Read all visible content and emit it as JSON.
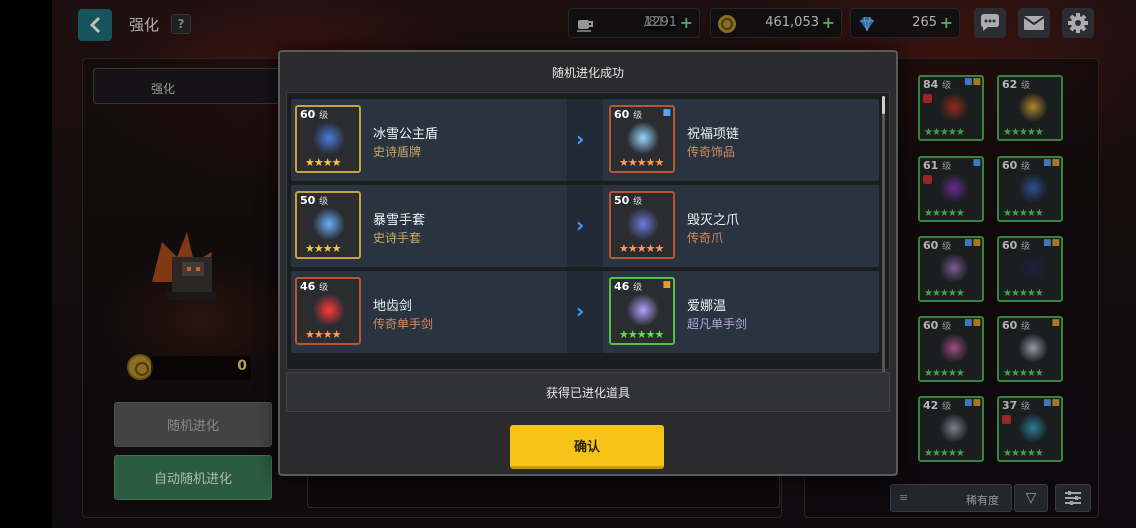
{
  "header": {
    "title": "强化",
    "help_label": "?",
    "stamina": {
      "current": "1291",
      "max": "/81"
    },
    "gold": "461,053",
    "gems": "265",
    "plus": "+"
  },
  "left": {
    "tab_label": "强化",
    "cost": "0",
    "random_evolve_label": "随机进化",
    "auto_evolve_label": "自动随机进化"
  },
  "inventory": {
    "items": [
      {
        "level": "84",
        "unit": "级",
        "stars": "★★★★★",
        "locked": true,
        "badges": [
          "blue",
          "orange"
        ]
      },
      {
        "level": "62",
        "unit": "级",
        "stars": "★★★★★",
        "locked": false,
        "badges": []
      },
      {
        "level": "61",
        "unit": "级",
        "stars": "★★★★★",
        "locked": true,
        "badges": [
          "blue"
        ]
      },
      {
        "level": "60",
        "unit": "级",
        "stars": "★★★★★",
        "locked": false,
        "badges": [
          "blue",
          "orange"
        ]
      },
      {
        "level": "60",
        "unit": "级",
        "stars": "★★★★★",
        "locked": false,
        "badges": [
          "blue",
          "orange"
        ]
      },
      {
        "level": "60",
        "unit": "级",
        "stars": "★★★★★",
        "locked": false,
        "badges": [
          "blue",
          "orange"
        ]
      },
      {
        "level": "60",
        "unit": "级",
        "stars": "★★★★★",
        "locked": false,
        "badges": [
          "blue",
          "orange"
        ]
      },
      {
        "level": "60",
        "unit": "级",
        "stars": "★★★★★",
        "locked": false,
        "badges": [
          "orange"
        ]
      },
      {
        "level": "42",
        "unit": "级",
        "stars": "★★★★★",
        "locked": false,
        "badges": [
          "blue",
          "orange"
        ]
      },
      {
        "level": "37",
        "unit": "级",
        "stars": "★★★★★",
        "locked": true,
        "badges": [
          "blue",
          "orange"
        ]
      }
    ],
    "sort_label": "稀有度",
    "sort_icon": "≡",
    "filter_icon": "▽"
  },
  "modal": {
    "title": "随机进化成功",
    "rows": [
      {
        "from": {
          "level": "60",
          "unit": "级",
          "name": "冰雪公主盾",
          "type": "史诗盾牌",
          "stars": "★★★★"
        },
        "to": {
          "level": "60",
          "unit": "级",
          "name": "祝福项链",
          "type": "传奇饰品",
          "stars": "★★★★★"
        }
      },
      {
        "from": {
          "level": "50",
          "unit": "级",
          "name": "暴雪手套",
          "type": "史诗手套",
          "stars": "★★★★"
        },
        "to": {
          "level": "50",
          "unit": "级",
          "name": "毁灭之爪",
          "type": "传奇爪",
          "stars": "★★★★★"
        }
      },
      {
        "from": {
          "level": "46",
          "unit": "级",
          "name": "地齿剑",
          "type": "传奇单手剑",
          "stars": "★★★★"
        },
        "to": {
          "level": "46",
          "unit": "级",
          "name": "爱娜温",
          "type": "超凡单手剑",
          "stars": "★★★★★"
        }
      }
    ],
    "footer_label": "获得已进化道具",
    "confirm_label": "确认",
    "arrow": "›"
  },
  "colors": {
    "accent_teal": "#1f6f78",
    "confirm_yellow": "#f6c419",
    "auto_green": "#3a7a56",
    "rarity_epic": "#c9a238",
    "rarity_legend": "#b9552f",
    "rarity_super": "#58c04a"
  }
}
